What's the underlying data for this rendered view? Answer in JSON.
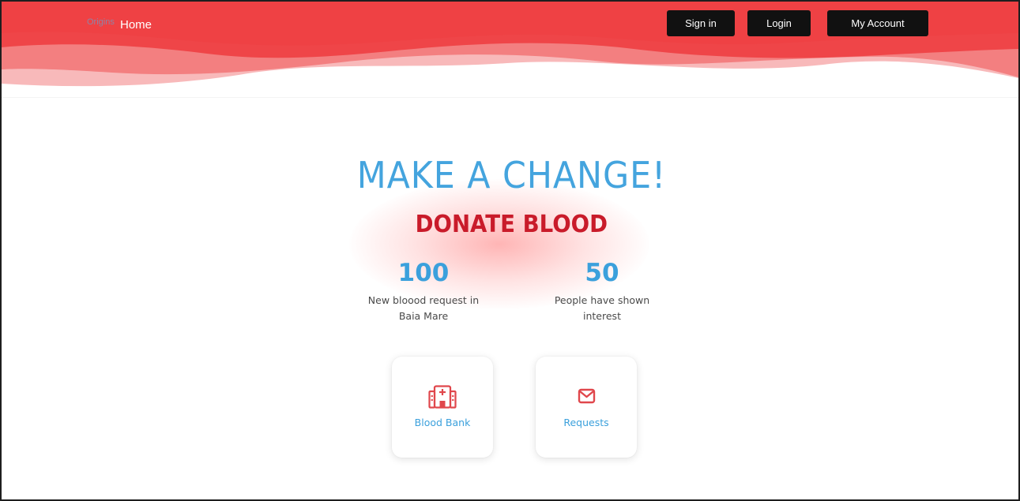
{
  "nav": {
    "brand": "Origins",
    "home": "Home",
    "buttons": {
      "signin": "Sign in",
      "login": "Login",
      "account": "My Account"
    }
  },
  "hero": {
    "headline": "MAKE A CHANGE!",
    "subheadline": "DONATE BLOOD"
  },
  "stats": [
    {
      "value": "100",
      "label": "New bloood request in Baia Mare"
    },
    {
      "value": "50",
      "label": "People have shown interest"
    }
  ],
  "cards": [
    {
      "label": "Blood Bank",
      "icon": "hospital-icon"
    },
    {
      "label": "Requests",
      "icon": "envelope-icon"
    }
  ],
  "colors": {
    "header_red": "#ef4548",
    "wave_light": "#f8b3b4",
    "accent_blue": "#3ba0dc",
    "donate_red": "#c91b2a",
    "icon_red": "#e0474c",
    "button_dark": "#111111"
  }
}
